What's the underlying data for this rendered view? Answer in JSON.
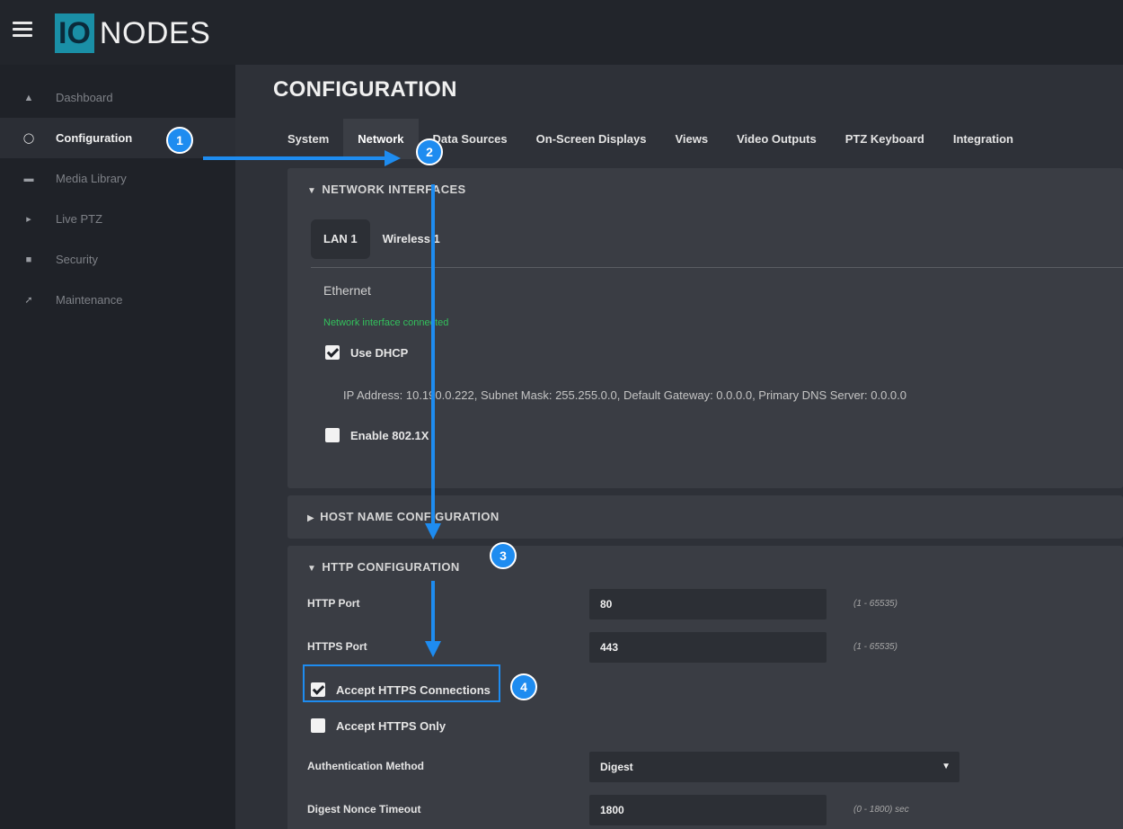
{
  "app": {
    "logo_mark": "IO",
    "logo_text": "NODES"
  },
  "sidebar": {
    "items": [
      {
        "label": "Dashboard",
        "icon": "home-icon"
      },
      {
        "label": "Configuration",
        "icon": "gear-icon",
        "active": true
      },
      {
        "label": "Media Library",
        "icon": "folder-icon"
      },
      {
        "label": "Live PTZ",
        "icon": "camera-icon"
      },
      {
        "label": "Security",
        "icon": "lock-icon"
      },
      {
        "label": "Maintenance",
        "icon": "wrench-icon"
      }
    ]
  },
  "main": {
    "title": "CONFIGURATION",
    "tabs": [
      {
        "label": "System"
      },
      {
        "label": "Network",
        "active": true
      },
      {
        "label": "Data Sources"
      },
      {
        "label": "On-Screen Displays"
      },
      {
        "label": "Views"
      },
      {
        "label": "Video Outputs"
      },
      {
        "label": "PTZ Keyboard"
      },
      {
        "label": "Integration"
      }
    ]
  },
  "network_interfaces": {
    "title": "NETWORK INTERFACES",
    "subtabs": [
      {
        "label": "LAN 1",
        "active": true
      },
      {
        "label": "Wireless 1"
      }
    ],
    "interface_type": "Ethernet",
    "status": "Network interface connected",
    "use_dhcp_label": "Use DHCP",
    "use_dhcp_checked": true,
    "ip_info": "IP Address: 10.190.0.222, Subnet Mask: 255.255.0.0, Default Gateway: 0.0.0.0, Primary DNS Server: 0.0.0.0",
    "enable_8021x_label": "Enable 802.1X",
    "enable_8021x_checked": false
  },
  "host_name": {
    "title": "HOST NAME CONFIGURATION"
  },
  "http_config": {
    "title": "HTTP CONFIGURATION",
    "http_port_label": "HTTP Port",
    "http_port_value": "80",
    "http_port_hint": "(1 - 65535)",
    "https_port_label": "HTTPS Port",
    "https_port_value": "443",
    "https_port_hint": "(1 - 65535)",
    "accept_https_label": "Accept HTTPS Connections",
    "accept_https_checked": true,
    "accept_https_only_label": "Accept HTTPS Only",
    "accept_https_only_checked": false,
    "auth_method_label": "Authentication Method",
    "auth_method_value": "Digest",
    "nonce_timeout_label": "Digest Nonce Timeout",
    "nonce_timeout_value": "1800",
    "nonce_timeout_hint": "(0 - 1800) sec"
  },
  "annotations": {
    "step1": "1",
    "step2": "2",
    "step3": "3",
    "step4": "4"
  },
  "colors": {
    "accent": "#1e8cf0",
    "status_ok": "#33c05c",
    "logo_box": "#1a8fa6"
  }
}
